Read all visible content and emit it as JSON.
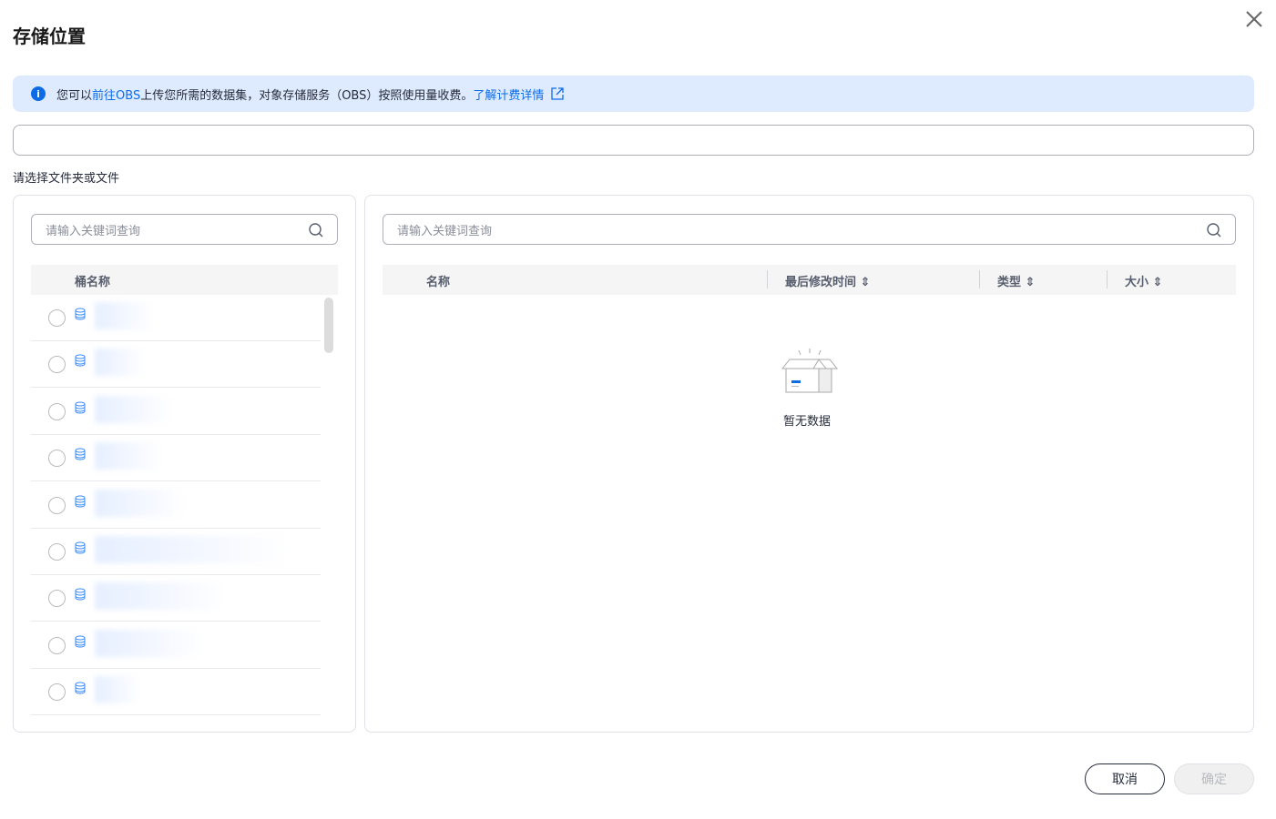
{
  "dialog": {
    "title": "存储位置"
  },
  "alert": {
    "prefix": "您可以",
    "link1": "前往OBS",
    "middle": "上传您所需的数据集，对象存储服务（OBS）按照使用量收费。",
    "link2": "了解计费详情"
  },
  "path_input": {
    "value": ""
  },
  "select_label": "请选择文件夹或文件",
  "left": {
    "search_placeholder": "请输入关键词查询",
    "column": "桶名称",
    "bucket_count": 9
  },
  "right": {
    "search_placeholder": "请输入关键词查询",
    "columns": [
      "名称",
      "最后修改时间",
      "类型",
      "大小"
    ],
    "empty_text": "暂无数据"
  },
  "footer": {
    "cancel": "取消",
    "confirm": "确定"
  },
  "colors": {
    "accent": "#0d6be8",
    "alert_bg": "#deebff"
  }
}
